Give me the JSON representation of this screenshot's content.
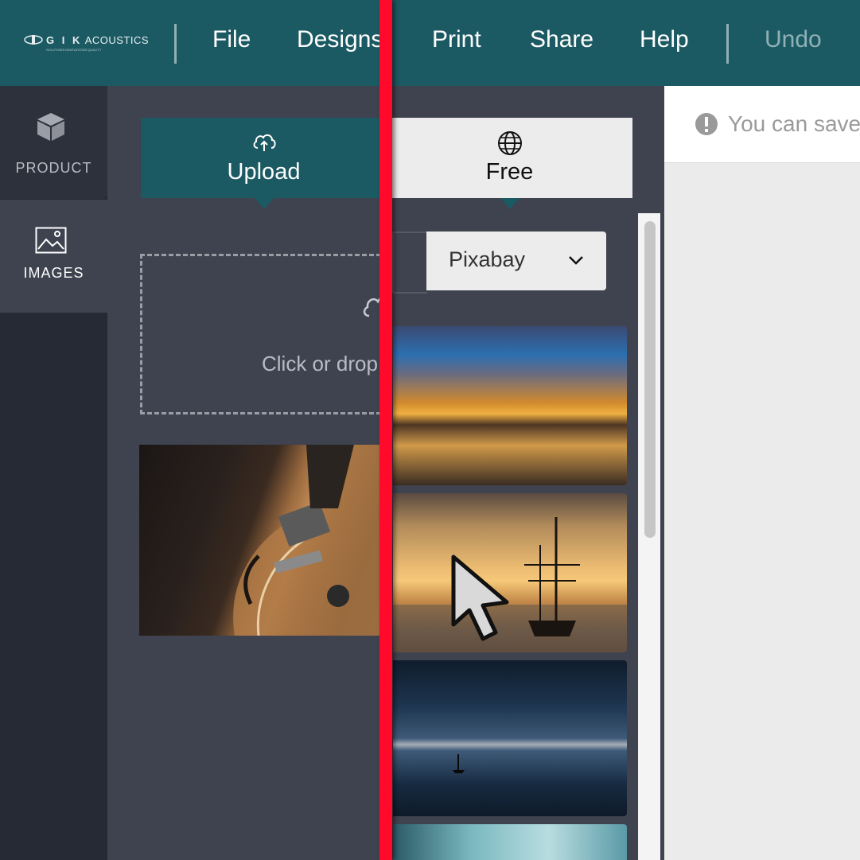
{
  "logo": {
    "brand_prefix": "G I K",
    "brand_suffix": "ACOUSTICS",
    "tagline": "SOLUTIONS INNOVATIONS QUALITY"
  },
  "menu": {
    "file": "File",
    "designs": "Designs",
    "print": "Print",
    "share": "Share",
    "help": "Help",
    "undo": "Undo"
  },
  "sidebar": {
    "product": "PRODUCT",
    "images": "IMAGES"
  },
  "tabs": {
    "upload": "Upload",
    "free": "Free"
  },
  "dropzone": {
    "text": "Click or drop"
  },
  "source_select": {
    "value": "Pixabay"
  },
  "notice": {
    "text": "You can save"
  },
  "colors": {
    "topbar": "#1c5a63",
    "accent_divider": "#ff0a2a",
    "panel": "#3f434f"
  },
  "icons": [
    "cube-icon",
    "image-icon",
    "cloud-upload-icon",
    "globe-icon",
    "cloud-icon",
    "chevron-down-icon",
    "alert-icon",
    "cursor-icon"
  ]
}
